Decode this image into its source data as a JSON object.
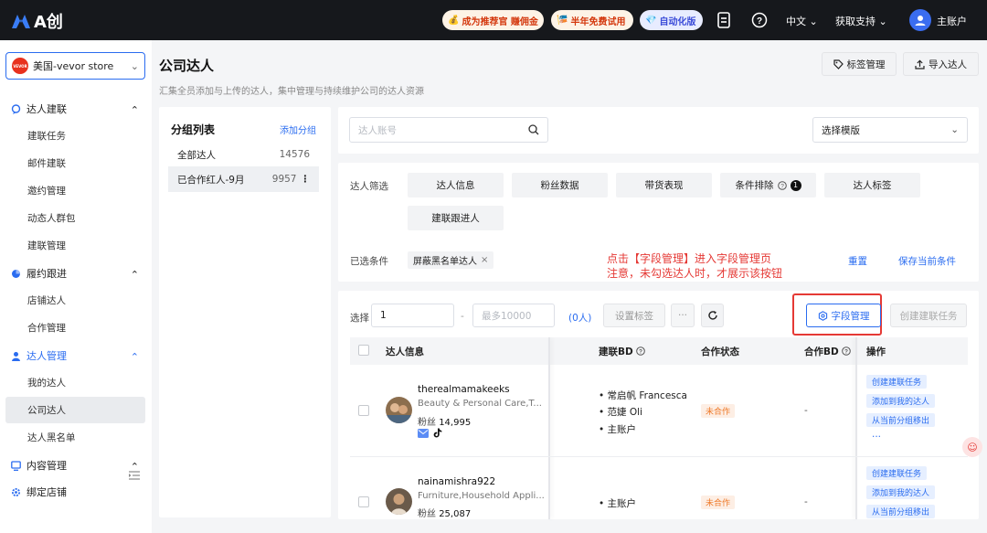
{
  "topbar": {
    "logo_text": "A创",
    "promo1": "成为推荐官 赚佣金",
    "promo2": "半年免费试用",
    "auto_version": "自动化版",
    "language": "中文",
    "support": "获取支持",
    "account": "主账户"
  },
  "sidebar": {
    "store_name": "美国-vevor store",
    "store_logo_text": "VEVOR",
    "groups": {
      "kol_contact": "达人建联",
      "fulfillment": "履约跟进",
      "kol_manage": "达人管理",
      "content": "内容管理",
      "bind_store": "绑定店铺"
    },
    "items": {
      "contact_task": "建联任务",
      "email_contact": "邮件建联",
      "invite_manage": "邀约管理",
      "dynamic_group": "动态人群包",
      "contact_manage": "建联管理",
      "shop_kol": "店铺达人",
      "coop_manage": "合作管理",
      "my_kol": "我的达人",
      "company_kol": "公司达人",
      "kol_blacklist": "达人黑名单"
    }
  },
  "header": {
    "title": "公司达人",
    "subtitle": "汇集全员添加与上传的达人，集中管理与持续维护公司的达人资源",
    "tag_manage": "标签管理",
    "import_kol": "导入达人"
  },
  "groups_panel": {
    "title": "分组列表",
    "add_group": "添加分组",
    "rows": [
      {
        "label": "全部达人",
        "count": "14576"
      },
      {
        "label": "已合作红人-9月",
        "count": "9957"
      }
    ]
  },
  "search": {
    "placeholder": "达人账号",
    "template_select": "选择模版"
  },
  "filters": {
    "label": "达人筛选",
    "buttons": [
      "达人信息",
      "粉丝数据",
      "带货表现",
      "条件排除",
      "达人标签",
      "建联跟进人"
    ],
    "exclude_count": "1",
    "selected_label": "已选条件",
    "selected_tag": "屏蔽黑名单达人",
    "reset": "重置",
    "save_conditions": "保存当前条件"
  },
  "annotation": {
    "line1": "点击【字段管理】进入字段管理页",
    "line2": "注意，未勾选达人时，才展示该按钮"
  },
  "toolbar": {
    "select_label": "选择",
    "from_value": "1",
    "dash": "-",
    "to_placeholder": "最多10000",
    "count": "(0人)",
    "set_tag": "设置标签",
    "more": "···",
    "field_manage": "字段管理",
    "create_task": "创建建联任务"
  },
  "table": {
    "headers": {
      "kol_info": "达人信息",
      "contact_bd": "建联BD",
      "coop_status": "合作状态",
      "coop_bd": "合作BD",
      "action": "操作"
    },
    "rows": [
      {
        "name": "therealmamakeeks",
        "category": "Beauty & Personal Care,T...",
        "fans_label": "粉丝",
        "fans": "14,995",
        "bd": [
          "• 常启帆 Francesca",
          "• 范婕 Oli",
          "• 主账户"
        ],
        "status": "未合作",
        "coop_bd": "-",
        "actions": [
          "创建建联任务",
          "添加到我的达人",
          "从当前分组移出",
          "···"
        ]
      },
      {
        "name": "nainamishra922",
        "category": "Furniture,Household Appli...",
        "fans_label": "粉丝",
        "fans": "25,087",
        "bd": [
          "• 主账户"
        ],
        "status": "未合作",
        "coop_bd": "-",
        "actions": [
          "创建建联任务",
          "添加到我的达人",
          "从当前分组移出"
        ]
      }
    ]
  },
  "colors": {
    "accent": "#2a6cf0",
    "annotation_red": "#e53935",
    "topbar_bg": "#16181c",
    "status_orange": "#ee7a2a"
  }
}
